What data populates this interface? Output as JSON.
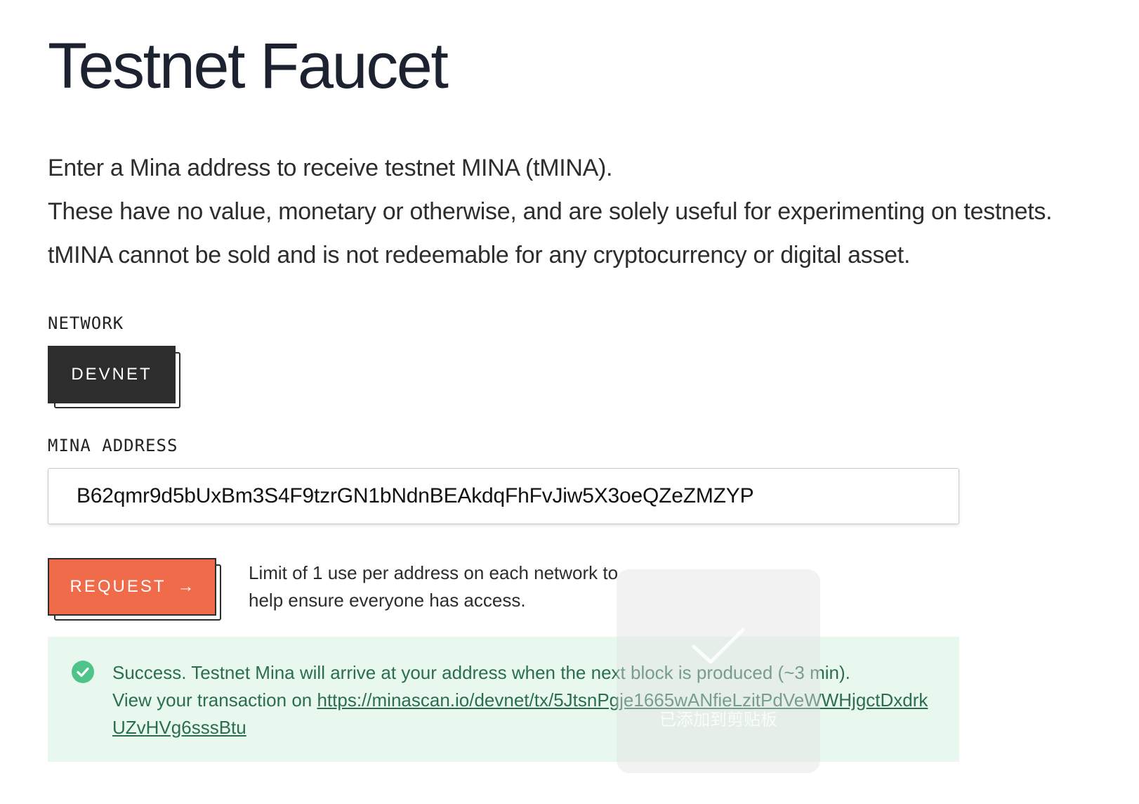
{
  "page": {
    "title": "Testnet Faucet",
    "intro": [
      "Enter a Mina address to receive testnet MINA (tMINA).",
      "These have no value, monetary or otherwise, and are solely useful for experimenting on testnets.",
      "tMINA cannot be sold and is not redeemable for any cryptocurrency or digital asset."
    ]
  },
  "network": {
    "label": "NETWORK",
    "selected": "DEVNET"
  },
  "address": {
    "label": "MINA ADDRESS",
    "value": "B62qmr9d5bUxBm3S4F9tzrGN1bNdnBEAkdqFhFvJiw5X3oeQZeZMZYP"
  },
  "request": {
    "label": "REQUEST",
    "arrow": "→",
    "limit_note": "Limit of 1 use per address on each network to help ensure everyone has access."
  },
  "success": {
    "icon": "check-circle-icon",
    "message": "Success. Testnet Mina will arrive at your address when the next block is produced (~3 min).",
    "view_prefix": "View your transaction on ",
    "tx_url": "https://minascan.io/devnet/tx/5JtsnPgje1665wANfieLzitPdVeWWHjgctDxdrkUZvHVg6sssBtu"
  },
  "toast": {
    "icon": "checkmark-icon",
    "text": "已添加到剪贴板"
  },
  "colors": {
    "title": "#1c2230",
    "devnet_bg": "#2d2d2d",
    "request_bg": "#f06b4a",
    "success_bg": "#e9f8ee",
    "success_text": "#2a6e4e",
    "success_icon": "#4fc48a"
  }
}
